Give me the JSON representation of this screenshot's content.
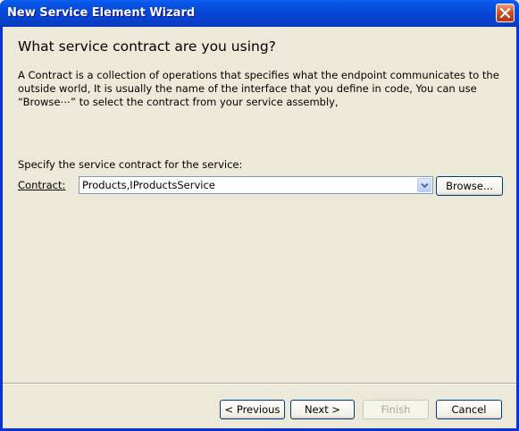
{
  "window": {
    "title": "New Service Element Wizard",
    "close_icon": "close-icon"
  },
  "page": {
    "heading": "What service contract are you using?",
    "description": "A Contract is a collection of operations that specifies what the endpoint communicates to the outside world, It is usually the name of the interface that you define in code, You can use “Browse⋯” to select the contract from your service assembly,",
    "spec_label": "Specify the service contract for the service:",
    "contract_label": "Contract:",
    "contract_value": "Products,IProductsService",
    "browse_label": "Browse..."
  },
  "footer": {
    "previous_label": "< Previous",
    "next_label": "Next >",
    "finish_label": "Finish",
    "cancel_label": "Cancel"
  },
  "colors": {
    "title_bar": "#0548d8",
    "close_button": "#c94a22",
    "dialog_background": "#ece9d8",
    "button_border": "#003c74"
  }
}
